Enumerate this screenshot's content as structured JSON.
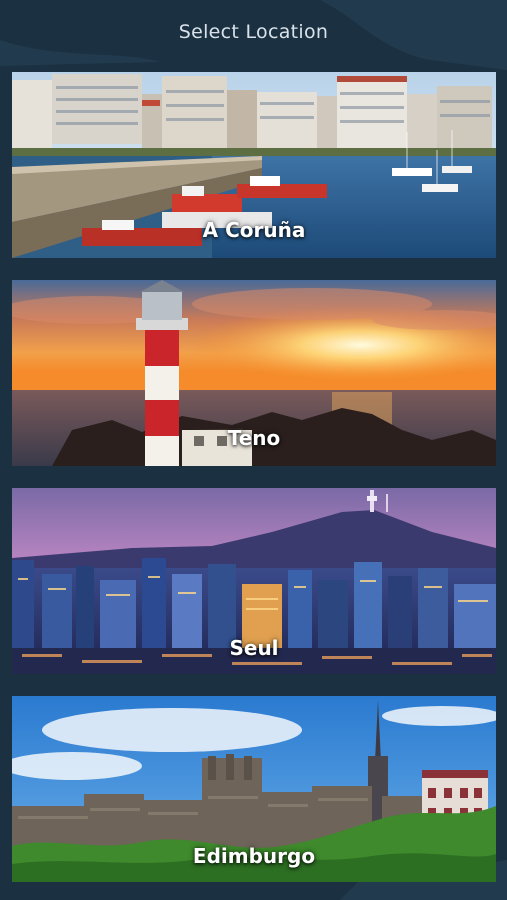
{
  "header": {
    "title": "Select Location"
  },
  "locations": [
    {
      "label": "A Coruña"
    },
    {
      "label": "Teno"
    },
    {
      "label": "Seul"
    },
    {
      "label": "Edimburgo"
    }
  ],
  "colors": {
    "background": "#1b3040",
    "title_text": "#d9e2ea",
    "label_text": "#ffffff"
  }
}
